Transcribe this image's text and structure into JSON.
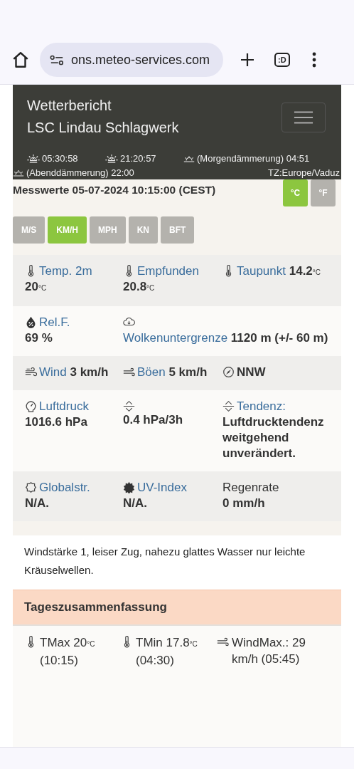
{
  "browser": {
    "url": "ons.meteo-services.com",
    "tab_count": ":D"
  },
  "header": {
    "title": "Wetterbericht",
    "station": "LSC Lindau Schlagwerk",
    "sun_times": [
      "05:30:58",
      "21:20:57",
      "(Morgendämmerung) 04:51",
      "(Abenddämmerung) 22:00"
    ],
    "timezone": "TZ:Europe/Vaduz"
  },
  "measurements": {
    "title": "Messwerte  05-07-2024 10:15:00 (CEST)",
    "temp_units": [
      {
        "label": "°C",
        "selected": true
      },
      {
        "label": "°F",
        "selected": false
      }
    ],
    "speed_units": [
      {
        "label": "M/S",
        "selected": false
      },
      {
        "label": "KM/H",
        "selected": true
      },
      {
        "label": "MPH",
        "selected": false
      },
      {
        "label": "KN",
        "selected": false
      },
      {
        "label": "BFT",
        "selected": false
      }
    ]
  },
  "rows": [
    {
      "cells": [
        {
          "label": "Temp. 2m",
          "linked": true,
          "kind": "stacked",
          "value": "20",
          "unit": "°C"
        },
        {
          "label": "Empfunden",
          "linked": true,
          "kind": "stacked",
          "value": "20.8",
          "unit": "°C"
        },
        {
          "label": "Taupunkt",
          "linked": true,
          "kind": "inline",
          "value": "14.2",
          "unit": "°C"
        }
      ]
    },
    {
      "cells": [
        {
          "label": "Rel.F.",
          "linked": true,
          "kind": "stacked",
          "value": "69 %"
        },
        {
          "label": "Wolkenuntergrenze",
          "linked": true,
          "kind": "inline",
          "value": "1120 m (+/- 60 m)"
        }
      ]
    },
    {
      "cells": [
        {
          "label": "Wind",
          "linked": true,
          "kind": "inline",
          "value": "3 km/h"
        },
        {
          "label": "Böen",
          "linked": true,
          "kind": "inline",
          "value": "5 km/h"
        },
        {
          "kind": "inline",
          "value": "NNW"
        }
      ]
    },
    {
      "cells": [
        {
          "label": "Luftdruck",
          "linked": true,
          "kind": "stacked",
          "value": "1016.6 hPa"
        },
        {
          "kind": "stacked",
          "value": "0.4 hPa/3h"
        },
        {
          "label": "Tendenz:",
          "linked": true,
          "kind": "stacked",
          "value": "Luftdrucktendenz weitgehend unverändert."
        }
      ]
    },
    {
      "cells": [
        {
          "label": "Globalstr.",
          "linked": true,
          "kind": "stacked",
          "value": "N/A."
        },
        {
          "label": "UV-Index",
          "linked": true,
          "kind": "stacked",
          "value": "N/A."
        },
        {
          "label": "Regenrate",
          "linked": false,
          "kind": "stacked",
          "value": "0 mm/h"
        }
      ]
    }
  ],
  "description": "Windstärke 1, leiser Zug, nahezu glattes Wasser nur leichte Kräuselwellen.",
  "summary": {
    "title": "Tageszusammenfassung",
    "items": [
      {
        "label": "TMax",
        "value": "20",
        "unit": "°C",
        "unit_small": true,
        "time": "(10:15)"
      },
      {
        "label": "TMin",
        "value": "17.8",
        "unit": "°C",
        "unit_small": true,
        "time": "(04:30)"
      },
      {
        "label": "WindMax.:",
        "value": "29",
        "unit": "km/h",
        "unit_small": false,
        "time": "(05:45)"
      }
    ]
  }
}
